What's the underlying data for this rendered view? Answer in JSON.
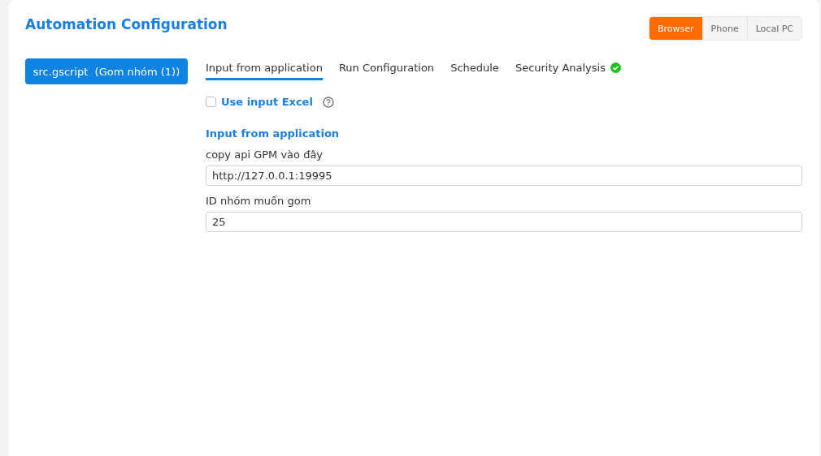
{
  "title": "Automation Configuration",
  "platforms": [
    {
      "label": "Browser",
      "selected": true
    },
    {
      "label": "Phone",
      "selected": false
    },
    {
      "label": "Local PC",
      "selected": false
    }
  ],
  "script_button": {
    "label": "src.gscript",
    "detail": "(Gom nhóm (1))"
  },
  "tabs": [
    {
      "label": "Input from application",
      "selected": true,
      "verified": false
    },
    {
      "label": "Run Configuration",
      "selected": false,
      "verified": false
    },
    {
      "label": "Schedule",
      "selected": false,
      "verified": false
    },
    {
      "label": "Security Analysis",
      "selected": false,
      "verified": true
    }
  ],
  "use_input_excel": {
    "label": "Use input Excel",
    "checked": false
  },
  "section_title": "Input from application",
  "fields": [
    {
      "label": "copy api GPM vào đây",
      "value": "http://127.0.0.1:19995"
    },
    {
      "label": "ID nhóm muốn gom",
      "value": "25"
    }
  ]
}
